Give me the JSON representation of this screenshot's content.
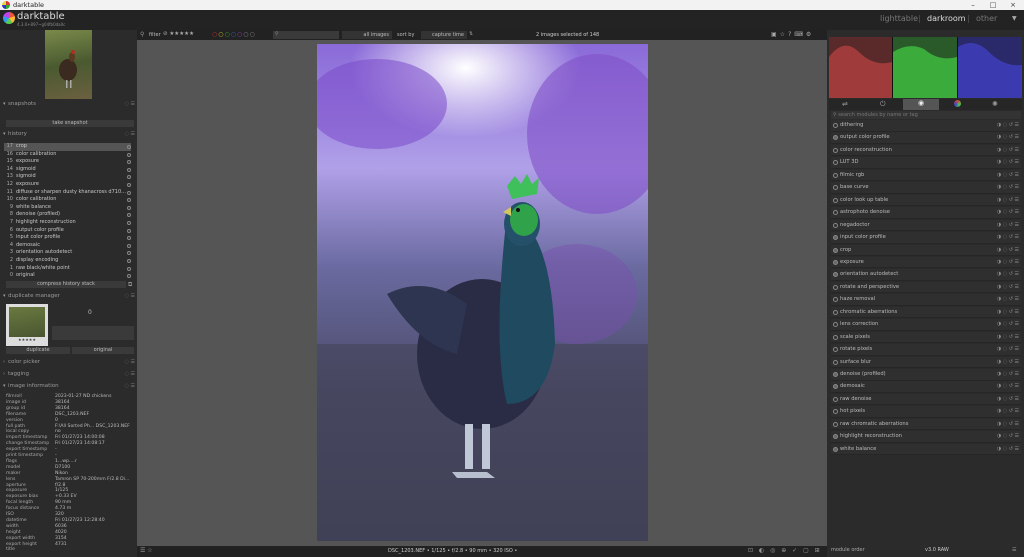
{
  "window": {
    "title": "darktable",
    "minimize": "–",
    "maximize": "□",
    "close": "×"
  },
  "app": {
    "name": "darktable",
    "version": "4.3.0+897~g04fb0da0c"
  },
  "views": [
    "lighttable",
    "darkroom",
    "other"
  ],
  "view_sep": "|",
  "left": {
    "snapshots": {
      "title": "snapshots",
      "button": "take snapshot"
    },
    "history": {
      "title": "history",
      "items": [
        {
          "n": "17",
          "label": "crop",
          "selected": true
        },
        {
          "n": "16",
          "label": "color calibration"
        },
        {
          "n": "15",
          "label": "exposure"
        },
        {
          "n": "14",
          "label": "sigmoid"
        },
        {
          "n": "13",
          "label": "sigmoid"
        },
        {
          "n": "12",
          "label": "exposure"
        },
        {
          "n": "11",
          "label": "diffuse or sharpen dusty khanacross d710..."
        },
        {
          "n": "10",
          "label": "color calibration"
        },
        {
          "n": "9",
          "label": "white balance"
        },
        {
          "n": "8",
          "label": "denoise (profiled)"
        },
        {
          "n": "7",
          "label": "highlight reconstruction"
        },
        {
          "n": "6",
          "label": "output color profile"
        },
        {
          "n": "5",
          "label": "input color profile"
        },
        {
          "n": "4",
          "label": "demosaic"
        },
        {
          "n": "3",
          "label": "orientation autodetect"
        },
        {
          "n": "2",
          "label": "display encoding"
        },
        {
          "n": "1",
          "label": "raw black/white point"
        },
        {
          "n": "0",
          "label": "original"
        }
      ],
      "compress": "compress history stack"
    },
    "duplicate": {
      "title": "duplicate manager",
      "count": "0",
      "stars": "★★★★★",
      "btn_duplicate": "duplicate",
      "btn_original": "original"
    },
    "color_picker": {
      "title": "color picker"
    },
    "tagging": {
      "title": "tagging"
    },
    "image_info": {
      "title": "image information",
      "rows": [
        {
          "k": "filmroll",
          "v": "2023-01-27 ND chickens"
        },
        {
          "k": "image id",
          "v": "38164"
        },
        {
          "k": "group id",
          "v": "38164"
        },
        {
          "k": "filename",
          "v": "DSC_1203.NEF"
        },
        {
          "k": "version",
          "v": "0"
        },
        {
          "k": "full path",
          "v": "F:\\All Sorted Ph... DSC_1203.NEF"
        },
        {
          "k": "local copy",
          "v": "no"
        },
        {
          "k": "import timestamp",
          "v": "Fri 01/27/23 14:00:08"
        },
        {
          "k": "change timestamp",
          "v": "Fri 01/27/23 14:08:17"
        },
        {
          "k": "export timestamp",
          "v": "-"
        },
        {
          "k": "print timestamp",
          "v": "-"
        },
        {
          "k": "flags",
          "v": "1...wp....r"
        },
        {
          "k": "model",
          "v": "D7100"
        },
        {
          "k": "maker",
          "v": "Nikon"
        },
        {
          "k": "lens",
          "v": "Tamron SP 70-200mm F/2.8 Di..."
        },
        {
          "k": "aperture",
          "v": "f/2.8"
        },
        {
          "k": "exposure",
          "v": "1/125"
        },
        {
          "k": "exposure bias",
          "v": "+0.33 EV"
        },
        {
          "k": "focal length",
          "v": "90 mm"
        },
        {
          "k": "focus distance",
          "v": "4.73 m"
        },
        {
          "k": "ISO",
          "v": "320"
        },
        {
          "k": "datetime",
          "v": "Fri 01/27/23 12:28:40"
        },
        {
          "k": "width",
          "v": "6036"
        },
        {
          "k": "height",
          "v": "4020"
        },
        {
          "k": "export width",
          "v": "3154"
        },
        {
          "k": "export height",
          "v": "4731"
        },
        {
          "k": "title",
          "v": ""
        }
      ]
    }
  },
  "filmstrip": {
    "filter_label": "filter",
    "rating": "⊘ ★★★★★",
    "collection": "all images",
    "sort_label": "sort by",
    "sort": "capture time",
    "selection": "2 images selected of 148"
  },
  "bottombar": {
    "info": "DSC_1203.NEF • 1/125 • f/2.8 • 90 mm • 320 ISO •",
    "left_icons": "☰ ☆",
    "right_icons": "⊡ ◐ ◎ ⊕ ✓ ▢ ⊞"
  },
  "right": {
    "search_placeholder": "search modules by name or tag",
    "module_order_label": "module order",
    "module_order_value": "v3.0 RAW",
    "modules": [
      {
        "label": "dithering",
        "on": false
      },
      {
        "label": "output color profile",
        "on": true
      },
      {
        "label": "color reconstruction",
        "on": false
      },
      {
        "label": "LUT 3D",
        "on": false
      },
      {
        "label": "filmic rgb",
        "on": false
      },
      {
        "label": "base curve",
        "on": false
      },
      {
        "label": "color look up table",
        "on": false
      },
      {
        "label": "astrophoto denoise",
        "on": false
      },
      {
        "label": "negadoctor",
        "on": false
      },
      {
        "label": "input color profile",
        "on": true
      },
      {
        "label": "crop",
        "on": true
      },
      {
        "label": "exposure",
        "on": true
      },
      {
        "label": "orientation autodetect",
        "on": true
      },
      {
        "label": "rotate and perspective",
        "on": false
      },
      {
        "label": "haze removal",
        "on": false
      },
      {
        "label": "chromatic aberrations",
        "on": false
      },
      {
        "label": "lens correction",
        "on": false
      },
      {
        "label": "scale pixels",
        "on": false
      },
      {
        "label": "rotate pixels",
        "on": false
      },
      {
        "label": "surface blur",
        "on": false
      },
      {
        "label": "denoise (profiled)",
        "on": true
      },
      {
        "label": "demosaic",
        "on": true
      },
      {
        "label": "raw denoise",
        "on": false
      },
      {
        "label": "hot pixels",
        "on": false
      },
      {
        "label": "raw chromatic aberrations",
        "on": false
      },
      {
        "label": "highlight reconstruction",
        "on": true
      },
      {
        "label": "white balance",
        "on": true
      }
    ]
  }
}
